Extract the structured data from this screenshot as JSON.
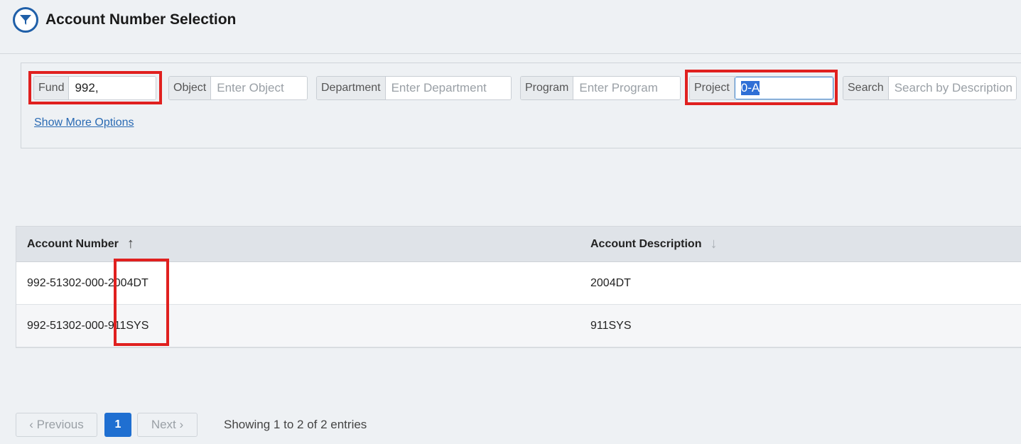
{
  "header": {
    "title": "Account Number Selection",
    "logo_icon": "filter-funnel-icon"
  },
  "filters": {
    "fund": {
      "label": "Fund",
      "value": "992,"
    },
    "object": {
      "label": "Object",
      "placeholder": "Enter Object"
    },
    "department": {
      "label": "Department",
      "placeholder": "Enter Department"
    },
    "program": {
      "label": "Program",
      "placeholder": "Enter Program"
    },
    "project": {
      "label": "Project",
      "value": "0-A"
    },
    "search": {
      "label": "Search",
      "placeholder": "Search by Description"
    },
    "show_more": "Show More Options"
  },
  "table": {
    "columns": [
      {
        "label": "Account Number",
        "sort": "↑"
      },
      {
        "label": "Account Description",
        "sort": "↓"
      }
    ],
    "rows": [
      {
        "number_prefix": "992-51302-000-",
        "number_suffix": "2004DT",
        "description": "2004DT"
      },
      {
        "number_prefix": "992-51302-000-",
        "number_suffix": "911SYS",
        "description": "911SYS"
      }
    ]
  },
  "pagination": {
    "previous": "‹ Previous",
    "current": "1",
    "next": "Next ›",
    "summary": "Showing 1 to 2 of 2 entries"
  },
  "colors": {
    "accent": "#1f6fd1",
    "highlight": "#e0201f",
    "brand": "#1f5fa8"
  }
}
